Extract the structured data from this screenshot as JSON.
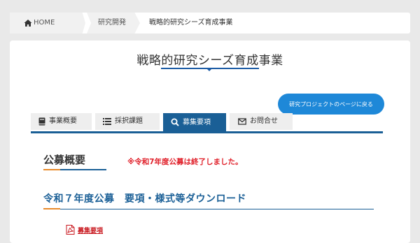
{
  "breadcrumb": {
    "home": "HOME",
    "parent": "研究開発",
    "current": "戦略的研究シーズ育成事業"
  },
  "page": {
    "title": "戦略的研究シーズ育成事業",
    "project_button": "研究プロジェクトのページに戻る"
  },
  "tabs": [
    {
      "label": "事業概要",
      "icon": "book-icon",
      "active": false
    },
    {
      "label": "採択課題",
      "icon": "list-icon",
      "active": false
    },
    {
      "label": "募集要項",
      "icon": "search-icon",
      "active": true
    },
    {
      "label": "お問合せ",
      "icon": "mail-icon",
      "active": false
    }
  ],
  "sections": {
    "overview_heading": "公募概要",
    "notice": "※令和7年度公募は終了しました。",
    "download_heading": "令和７年度公募　要項・様式等ダウンロード",
    "pdf_link": "募集要項"
  },
  "colors": {
    "accent_blue": "#1a5f96",
    "button_blue": "#1e88d8",
    "notice_red": "#e0202a",
    "accent_orange": "#e88a2a"
  }
}
